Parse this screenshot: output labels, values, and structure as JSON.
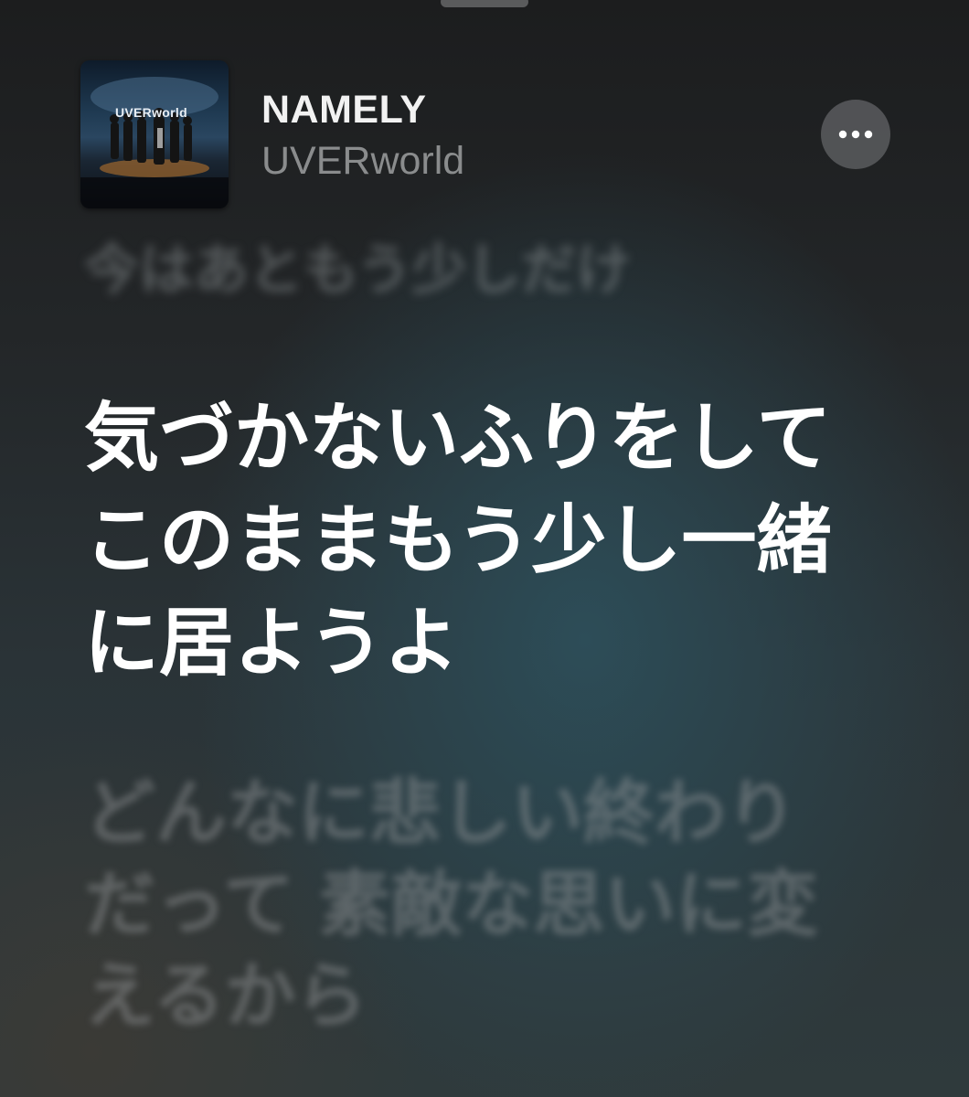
{
  "header": {
    "song_title": "NAMELY",
    "artist": "UVERworld",
    "artwork_text": "UVERworld",
    "more_icon": "ellipsis-icon"
  },
  "lyrics": {
    "previous": "今はあともう少しだけ",
    "current": [
      "気づかないふりをして",
      "このままもう少し一緒",
      "に居ようよ"
    ],
    "next": [
      "どんなに悲しい終わり",
      "だって 素敵な思いに変",
      "えるから"
    ]
  },
  "colors": {
    "current_lyric": "#ffffff",
    "artist_text": "#8a8c8d",
    "background_accent": "#2d4d58"
  }
}
